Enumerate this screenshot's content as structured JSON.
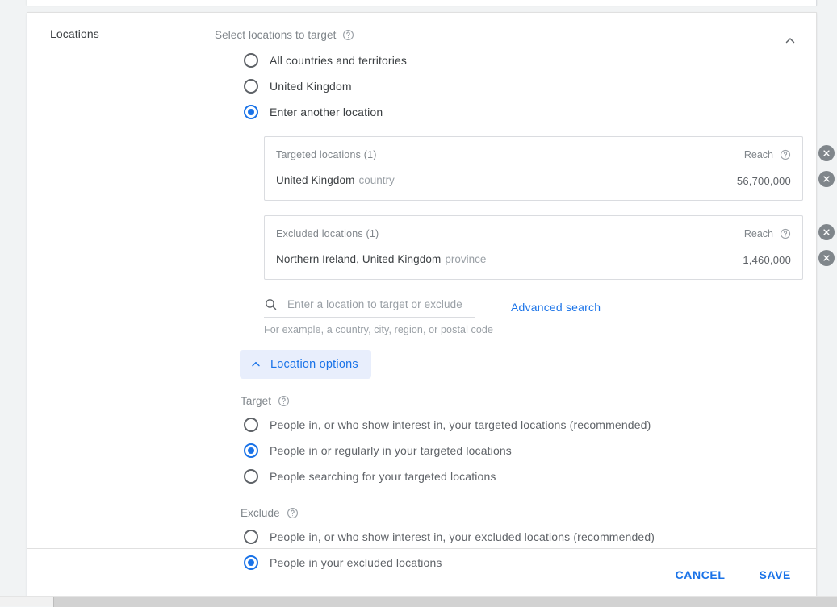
{
  "section": {
    "label": "Locations",
    "collapse_icon": "chevron-up-icon"
  },
  "target_select": {
    "heading": "Select locations to target",
    "help_icon": "help-icon",
    "options": [
      {
        "label": "All countries and territories",
        "selected": false
      },
      {
        "label": "United Kingdom",
        "selected": false
      },
      {
        "label": "Enter another location",
        "selected": true
      }
    ]
  },
  "targeted_card": {
    "title": "Targeted locations (1)",
    "reach_label": "Reach",
    "help_icon": "help-icon",
    "remove_header_icon": "close-circle-icon",
    "rows": [
      {
        "name": "United Kingdom",
        "type": "country",
        "reach": "56,700,000",
        "remove_icon": "close-circle-icon"
      }
    ]
  },
  "excluded_card": {
    "title": "Excluded locations (1)",
    "reach_label": "Reach",
    "help_icon": "help-icon",
    "remove_header_icon": "close-circle-icon",
    "rows": [
      {
        "name": "Northern Ireland, United Kingdom",
        "type": "province",
        "reach": "1,460,000",
        "remove_icon": "close-circle-icon"
      }
    ]
  },
  "search": {
    "icon": "search-icon",
    "value": "",
    "placeholder": "Enter a location to target or exclude",
    "advanced_label": "Advanced search",
    "hint": "For example, a country, city, region, or postal code"
  },
  "location_options": {
    "label": "Location options",
    "chevron_icon": "chevron-up-icon",
    "expanded": true,
    "target": {
      "heading": "Target",
      "help_icon": "help-icon",
      "options": [
        {
          "label": "People in, or who show interest in, your targeted locations (recommended)",
          "selected": false
        },
        {
          "label": "People in or regularly in your targeted locations",
          "selected": true
        },
        {
          "label": "People searching for your targeted locations",
          "selected": false
        }
      ]
    },
    "exclude": {
      "heading": "Exclude",
      "help_icon": "help-icon",
      "options": [
        {
          "label": "People in, or who show interest in, your excluded locations (recommended)",
          "selected": false
        },
        {
          "label": "People in your excluded locations",
          "selected": true
        }
      ]
    }
  },
  "footer": {
    "cancel_label": "CANCEL",
    "save_label": "SAVE"
  },
  "colors": {
    "accent": "#1a73e8",
    "text_primary": "#3c4043",
    "text_secondary": "#5f6368",
    "text_muted": "#9aa0a6",
    "chip_bg": "#e8eefc",
    "border": "#dadce0",
    "page_bg": "#f1f3f4"
  }
}
